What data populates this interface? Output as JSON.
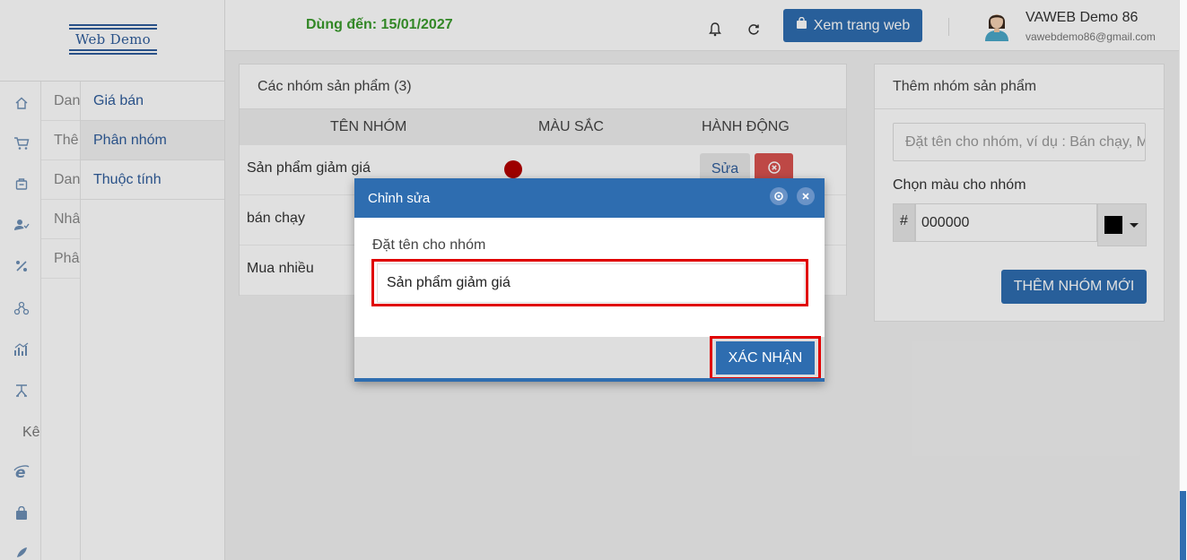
{
  "app": {
    "logo_text": "Web Demo",
    "expiry": "Dùng đến: 15/01/2027",
    "view_web_label": "Xem trang web",
    "user_name": "VAWEB Demo 86",
    "user_email": "vawebdemo86@gmail.com"
  },
  "rail_icons": [
    "home-icon",
    "cart-icon",
    "box-icon",
    "user-check-icon",
    "percent-icon",
    "network-icon",
    "chart-icon",
    "hierarchy-icon",
    "ie-icon",
    "bag-icon",
    "rocket-icon"
  ],
  "menu2": {
    "items": [
      "Dan",
      "Thê",
      "Dan",
      "Nhâ",
      "Phâ"
    ],
    "ke_label": "Kê"
  },
  "submenu": {
    "items": [
      "Giá bán",
      "Phân nhóm",
      "Thuộc tính"
    ],
    "active_index": 1
  },
  "groups_panel": {
    "title": "Các nhóm sản phẩm (3)",
    "columns": [
      "TÊN NHÓM",
      "MÀU SẮC",
      "HÀNH ĐỘNG"
    ],
    "rows": [
      {
        "name": "Sản phẩm giảm giá",
        "color": "#b30000",
        "edit_label": "Sửa"
      },
      {
        "name": "bán chạy"
      },
      {
        "name": "Mua nhiều"
      }
    ]
  },
  "add_panel": {
    "title": "Thêm nhóm sản phẩm",
    "name_placeholder": "Đặt tên cho nhóm, ví dụ : Bán chạy, Mới về,...",
    "color_label": "Chọn màu cho nhóm",
    "hash": "#",
    "color_value": "000000",
    "add_button": "THÊM NHÓM MỚI"
  },
  "modal": {
    "title": "Chỉnh sửa",
    "field_label": "Đặt tên cho nhóm",
    "field_value": "Sản phẩm giảm giá",
    "confirm_label": "XÁC NHẬN"
  },
  "colors": {
    "primary": "#2e6db0",
    "expiry_green": "#3a9a2c",
    "highlight_red": "#e00000",
    "danger": "#d9534f"
  }
}
